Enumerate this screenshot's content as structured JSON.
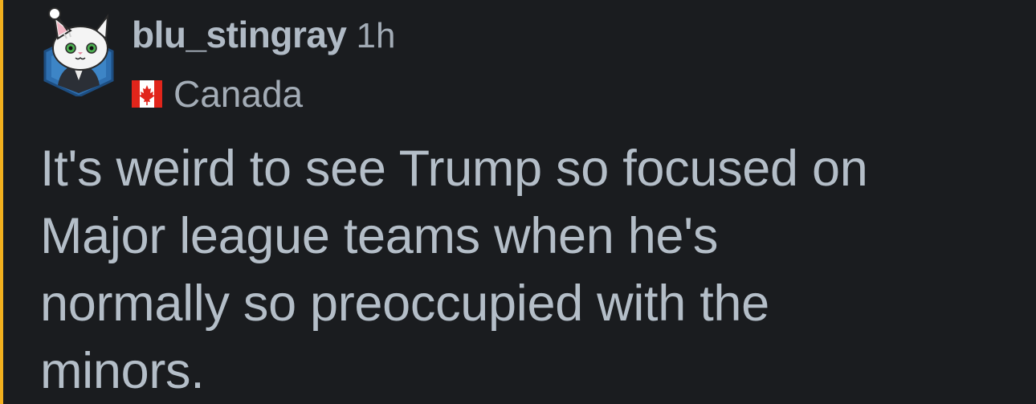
{
  "theme": {
    "background": "#1a1c1f",
    "thread_line_color": "#f2b01e",
    "username_color": "#b0bac5",
    "meta_color": "#a3acb6",
    "body_color": "#b4bec8"
  },
  "comment": {
    "avatar_icon": "cat-avatar-icon",
    "username": "blu_stingray",
    "timestamp": "1h",
    "flair": {
      "icon": "canada-flag-icon",
      "text": "Canada"
    },
    "body_lines": [
      "It's weird to see Trump so focused on",
      "Major league teams when he's",
      "normally so preoccupied with the",
      "minors."
    ]
  }
}
